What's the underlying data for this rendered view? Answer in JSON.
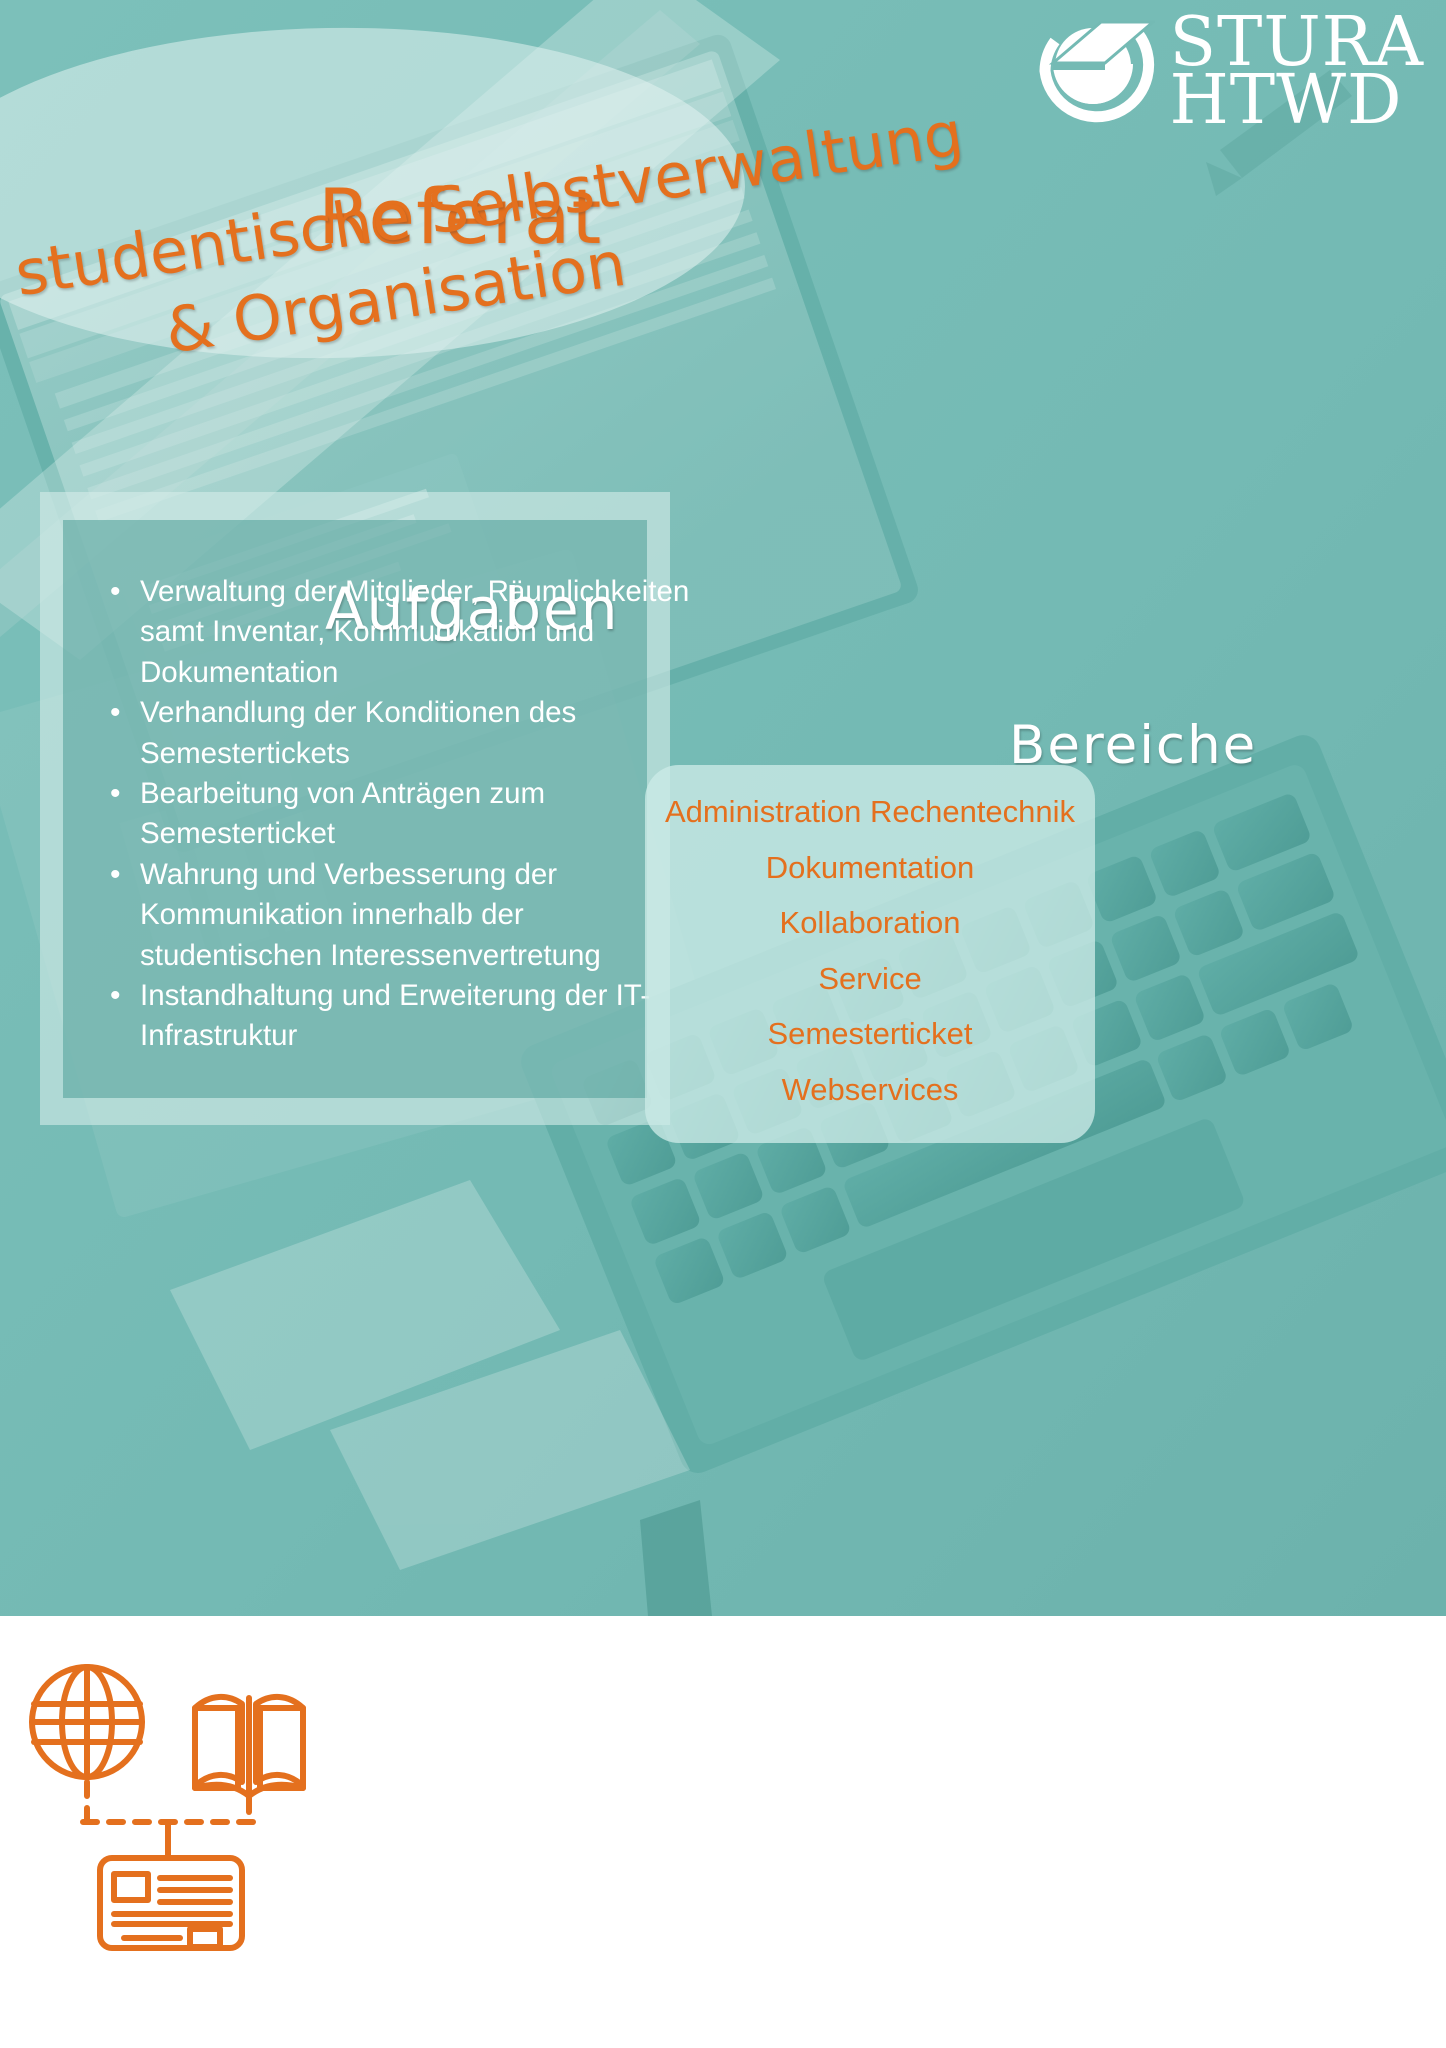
{
  "logo": {
    "mark": "graduation-cap-circle-icon",
    "line1": "STURA",
    "line2": "HTWD"
  },
  "title": {
    "main": "Referat",
    "sub_line1": "studentische Selbstverwaltung",
    "sub_line2": "& Organisation"
  },
  "aufgaben": {
    "heading": "Aufgaben",
    "bullet": "•",
    "items": [
      "Verwaltung der Mitglieder, Räumlichkeiten samt Inventar, Kommunikation und Dokumentation",
      "Verhandlung der Konditionen des Semestertickets",
      "Bearbeitung von Anträgen zum Semesterticket",
      "Wahrung und Verbesserung der Kommunikation innerhalb der studentischen Interessenvertretung",
      "Instandhaltung und Erweiterung der IT-Infrastruktur"
    ]
  },
  "bereiche": {
    "heading": "Bereiche",
    "items": [
      "Administration Rechentechnik",
      "Dokumentation",
      "Kollaboration",
      "Service",
      "Semesterticket",
      "Webservices"
    ]
  },
  "footer": {
    "icons": [
      "globe-icon",
      "open-book-icon",
      "id-card-icon"
    ],
    "connector": "dashed-connector-line"
  },
  "colors": {
    "teal_background": "#74bab4",
    "teal_panel": "#58a59e",
    "light_panel": "#cceae7",
    "orange_accent": "#e4701e",
    "white": "#ffffff"
  }
}
